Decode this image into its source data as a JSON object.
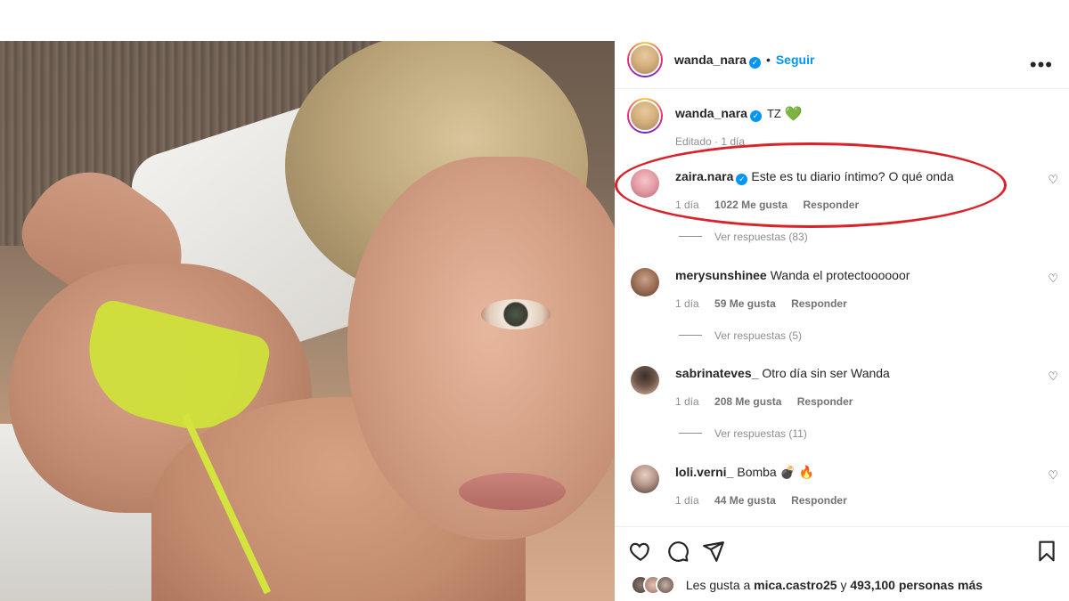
{
  "post": {
    "author": "wanda_nara",
    "follow_label": "Seguir",
    "dot": "•",
    "more_icon": "more-options-icon",
    "caption_text": "TZ",
    "caption_emoji": "💚",
    "edited_label": "Editado · 1 día"
  },
  "comments": [
    {
      "user": "zaira.nara",
      "verified": true,
      "text": "Este es tu diario íntimo? O qué onda",
      "time": "1 día",
      "likes": "1022 Me gusta",
      "reply_label": "Responder",
      "view_replies": "Ver respuestas (83)",
      "highlighted": true
    },
    {
      "user": "merysunshinee",
      "verified": false,
      "text": "Wanda el protectoooooor",
      "time": "1 día",
      "likes": "59 Me gusta",
      "reply_label": "Responder",
      "view_replies": "Ver respuestas (5)"
    },
    {
      "user": "sabrinateves_",
      "verified": false,
      "text": "Otro día sin ser Wanda",
      "time": "1 día",
      "likes": "208 Me gusta",
      "reply_label": "Responder",
      "view_replies": "Ver respuestas (11)"
    },
    {
      "user": "loli.verni_",
      "verified": false,
      "text": "Bomba 💣 🔥",
      "time": "1 día",
      "likes": "44 Me gusta",
      "reply_label": "Responder"
    }
  ],
  "likes_summary": {
    "prefix": "Les gusta a",
    "user": "mica.castro25",
    "connector": "y",
    "count": "493,100 personas más"
  },
  "colors": {
    "accent": "#0095f6",
    "highlight": "#d8232a",
    "muted": "#8e8e8e"
  }
}
